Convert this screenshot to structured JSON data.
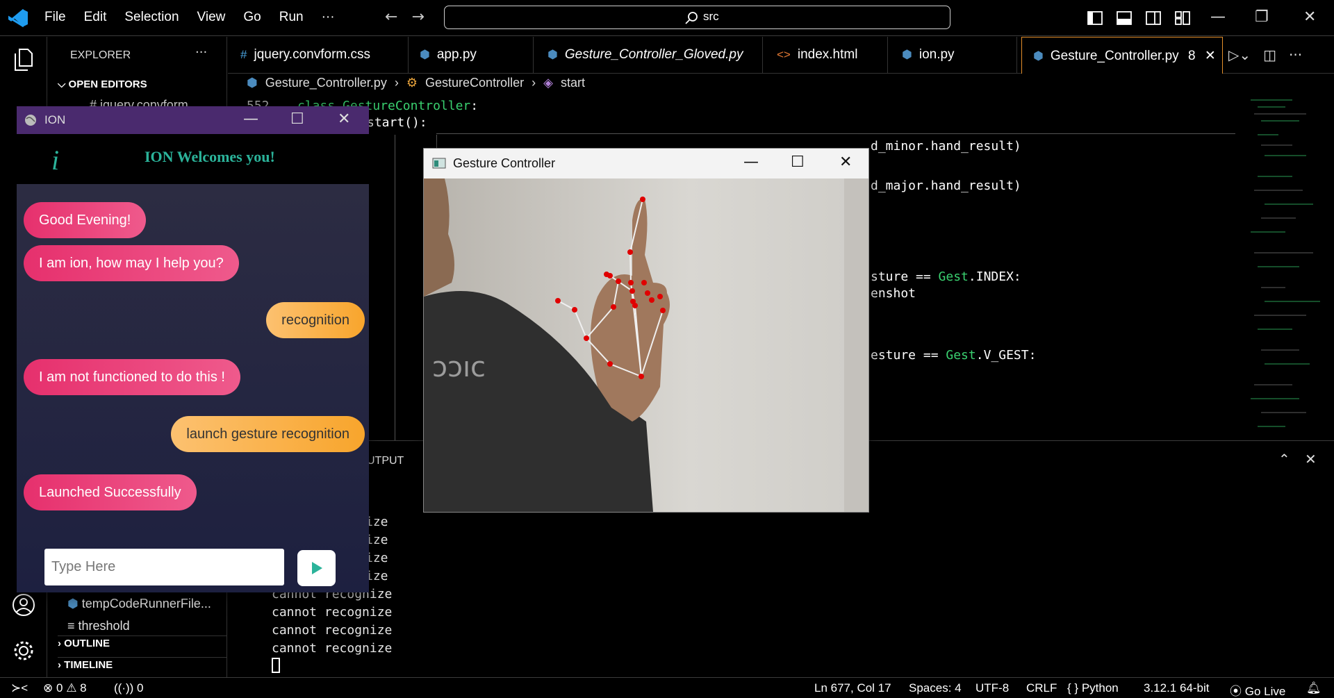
{
  "menu": [
    "File",
    "Edit",
    "Selection",
    "View",
    "Go",
    "Run",
    "···"
  ],
  "command_center": {
    "text": "src"
  },
  "explorer": {
    "title": "EXPLORER",
    "more": "···",
    "open_editors": "OPEN EDITORS",
    "open_editors_first": "# jquery.convform...",
    "files": [
      "tempCodeRunnerFile...",
      "threshold"
    ],
    "outline": "OUTLINE",
    "timeline": "TIMELINE"
  },
  "tabs": [
    {
      "icon": "#",
      "label": "jquery.convform.css"
    },
    {
      "icon": "py",
      "label": "app.py"
    },
    {
      "icon": "py",
      "label": "Gesture_Controller_Gloved.py"
    },
    {
      "icon": "<>",
      "label": "index.html"
    },
    {
      "icon": "py",
      "label": "ion.py"
    },
    {
      "icon": "py",
      "label": "Gesture_Controller.py",
      "badge": "8",
      "close": "✕"
    }
  ],
  "breadcrumb": [
    "Gesture_Controller.py",
    "GestureController",
    "start"
  ],
  "code": {
    "line_no": "552",
    "line1_kw": "class",
    "line1_cls": "GestureController",
    "line1_colon": ":",
    "line2": "start():",
    "right1": "d_minor.hand_result)",
    "right2": "d_major.hand_result)",
    "right3_a": "sture == ",
    "right3_b": "Gest",
    "right3_c": ".INDEX:",
    "right4": "enshot",
    "right5_a": "esture == ",
    "right5_b": "Gest",
    "right5_c": ".V_GEST:"
  },
  "panel": {
    "title": "UTPUT",
    "terminal_lines": [
      "ize",
      "ize",
      "ize",
      "ize",
      "cannot recognize",
      "cannot recognize",
      "cannot recognize",
      "cannot recognize"
    ]
  },
  "statusbar": {
    "problems_errors": "0",
    "problems_warnings": "8",
    "ports": "0",
    "position": "Ln 677, Col 17",
    "spaces": "Spaces: 4",
    "encoding": "UTF-8",
    "eol": "CRLF",
    "language": "Python",
    "interpreter": "3.12.1 64-bit",
    "golive": "Go Live"
  },
  "ion_window": {
    "title": "ION",
    "welcome": "ION Welcomes you!",
    "logo": "i",
    "messages": [
      {
        "from": "bot",
        "text": "Good Evening!"
      },
      {
        "from": "bot",
        "text": "I am ion, how may I help you?"
      },
      {
        "from": "user",
        "text": "recognition"
      },
      {
        "from": "bot",
        "text": "I am not functioned to do this !"
      },
      {
        "from": "user",
        "text": "launch gesture recognition"
      },
      {
        "from": "bot",
        "text": "Launched Successfully"
      }
    ],
    "input_placeholder": "Type Here"
  },
  "gesture_window": {
    "title": "Gesture Controller",
    "shirt_text": "ɔɔıc"
  },
  "colors": {
    "bot_bubble": "#e6306d",
    "user_bubble": "#f8a52c",
    "accent_tab": "#e58f2a",
    "code_keyword": "#3ad170",
    "ion_teal": "#2bb39a"
  }
}
